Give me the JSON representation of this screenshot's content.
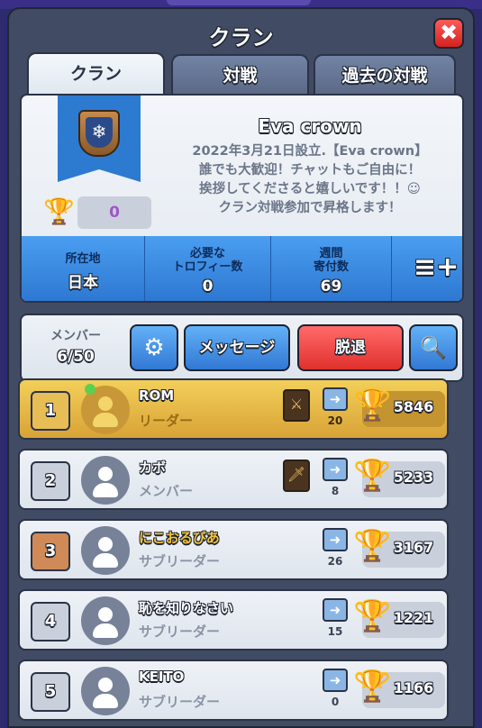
{
  "header": {
    "title": "クラン",
    "close_label": "✖"
  },
  "tabs": [
    {
      "label": "クラン",
      "active": true
    },
    {
      "label": "対戦",
      "active": false
    },
    {
      "label": "過去の対戦",
      "active": false
    }
  ],
  "clan": {
    "name": "Eva crown",
    "description_lines": [
      "2022年3月21日設立.【Eva crown】",
      "誰でも大歓迎！チャットもご自由に！",
      "挨拶してくださると嬉しいです！！☺",
      "クラン対戦参加で昇格します！"
    ],
    "required_trophies_badge": "0",
    "stats": [
      {
        "label": "所在地",
        "value": "日本"
      },
      {
        "label": "必要な\nトロフィー数",
        "value": "0"
      },
      {
        "label": "週間\n寄付数",
        "value": "69"
      }
    ]
  },
  "actions": {
    "members_label": "メンバー",
    "members_count": "6/50",
    "message_label": "メッセージ",
    "leave_label": "脱退"
  },
  "members": [
    {
      "rank": "1",
      "name": "ROM",
      "role": "リーダー",
      "donations": "20",
      "trophies": "5846"
    },
    {
      "rank": "2",
      "name": "カボ",
      "role": "メンバー",
      "donations": "8",
      "trophies": "5233"
    },
    {
      "rank": "3",
      "name": "にこおるびあ",
      "role": "サブリーダー",
      "donations": "26",
      "trophies": "3167"
    },
    {
      "rank": "4",
      "name": "恥を知りなさい",
      "role": "サブリーダー",
      "donations": "15",
      "trophies": "1221"
    },
    {
      "rank": "5",
      "name": "KEITO",
      "role": "サブリーダー",
      "donations": "0",
      "trophies": "1166"
    }
  ]
}
